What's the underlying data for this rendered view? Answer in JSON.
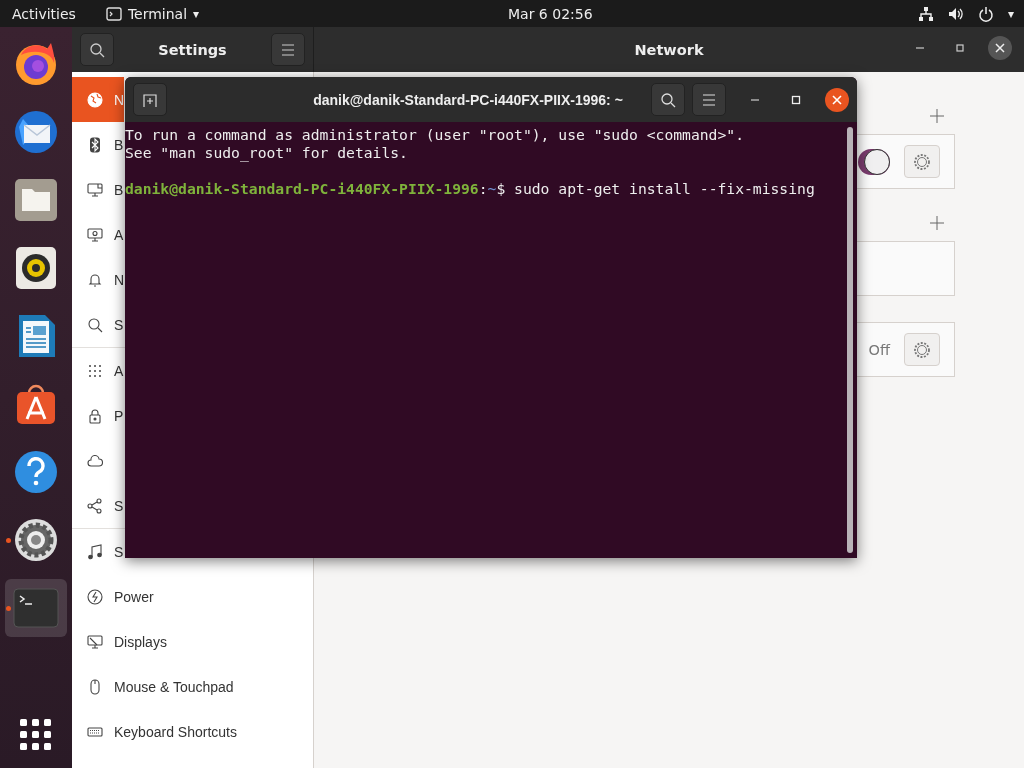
{
  "top_bar": {
    "activities": "Activities",
    "app_menu": "Terminal",
    "app_menu_caret": "▾",
    "clock": "Mar 6  02:56",
    "status_caret": "▾"
  },
  "dock": {
    "items": [
      {
        "kind": "browser",
        "running": false,
        "selected": false
      },
      {
        "kind": "mail",
        "running": false,
        "selected": false
      },
      {
        "kind": "folder",
        "running": false,
        "selected": false
      },
      {
        "kind": "speaker",
        "running": false,
        "selected": false
      },
      {
        "kind": "document",
        "running": false,
        "selected": false
      },
      {
        "kind": "store",
        "running": false,
        "selected": false
      },
      {
        "kind": "help",
        "running": false,
        "selected": false
      },
      {
        "kind": "settings",
        "running": true,
        "selected": false
      },
      {
        "kind": "terminal",
        "running": true,
        "selected": true
      }
    ]
  },
  "settings_window": {
    "title": "Settings",
    "panel_title": "Network",
    "sidebar": {
      "groups": [
        {
          "items": [
            {
              "label": "N",
              "kind": "globe",
              "selected": true
            },
            {
              "label": "B",
              "kind": "bluetooth",
              "selected": false
            },
            {
              "label": "B",
              "kind": "background",
              "selected": false
            },
            {
              "label": "A",
              "kind": "appearance",
              "selected": false
            },
            {
              "label": "N",
              "kind": "bell",
              "selected": false
            },
            {
              "label": "S",
              "kind": "search",
              "selected": false
            }
          ]
        },
        {
          "items": [
            {
              "label": "A",
              "kind": "grid",
              "selected": false
            },
            {
              "label": "P",
              "kind": "lock",
              "selected": false
            },
            {
              "kind": "cloud",
              "selected": false
            },
            {
              "label": "S",
              "kind": "share",
              "selected": false
            }
          ]
        },
        {
          "items": [
            {
              "label": "S",
              "kind": "music",
              "selected": false
            },
            {
              "label": "Power",
              "kind": "power",
              "selected": false
            },
            {
              "label": "Displays",
              "kind": "display",
              "selected": false
            },
            {
              "label": "Mouse & Touchpad",
              "kind": "mouse",
              "selected": false
            },
            {
              "label": "Keyboard Shortcuts",
              "kind": "keyboard",
              "selected": false
            }
          ]
        }
      ]
    },
    "network": {
      "sections": [
        {
          "add_button": true,
          "cards": [
            {
              "kind": "toggle",
              "on": true,
              "settings_button": true
            }
          ]
        },
        {
          "add_button": true,
          "cards": [
            {
              "kind": "empty",
              "settings_button": false
            }
          ]
        },
        {
          "add_button": false,
          "cards": [
            {
              "kind": "status",
              "status": "Off",
              "settings_button": true
            }
          ]
        }
      ]
    }
  },
  "terminal": {
    "title": "danik@danik-Standard-PC-i440FX-PIIX-1996: ~",
    "output": [
      "To run a command as administrator (user \"root\"), use \"sudo <command>\".",
      "See \"man sudo_root\" for details."
    ],
    "prompt": {
      "user": "danik@danik-Standard-PC-i440FX-PIIX-1996",
      "separator": ":",
      "path": "~",
      "command": "$ sudo apt-get install --fix-missing"
    }
  }
}
